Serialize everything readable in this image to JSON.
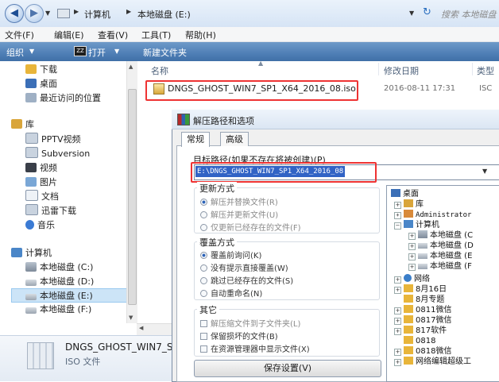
{
  "addressbar": {
    "crumbs": [
      "计算机",
      "本地磁盘 (E:)"
    ],
    "search_placeholder": "搜索 本地磁盘"
  },
  "menu": [
    "文件(F)",
    "编辑(E)",
    "查看(V)",
    "工具(T)",
    "帮助(H)"
  ],
  "toolbar": {
    "organize": "组织",
    "open": "打开",
    "new_folder": "新建文件夹"
  },
  "nav": {
    "favorites": [
      "下载",
      "桌面",
      "最近访问的位置"
    ],
    "library": "库",
    "library_items": [
      "PPTV视频",
      "Subversion",
      "视频",
      "图片",
      "文档",
      "迅雷下载",
      "音乐"
    ],
    "computer": "计算机",
    "drives": [
      "本地磁盘 (C:)",
      "本地磁盘 (D:)",
      "本地磁盘 (E:)",
      "本地磁盘 (F:)"
    ]
  },
  "filelist": {
    "columns": [
      "名称",
      "修改日期",
      "类型"
    ],
    "file": {
      "name": "DNGS_GHOST_WIN7_SP1_X64_2016_08.iso",
      "date": "2016-08-11 17:31",
      "type": "ISC"
    }
  },
  "details": {
    "name": "DNGS_GHOST_WIN7_S",
    "type": "ISO 文件"
  },
  "dialog": {
    "title": "解压路径和选项",
    "tabs": [
      "常规",
      "高级"
    ],
    "path_label": "目标路径(如果不存在将被创建)(P)",
    "path_value": "E:\\DNGS_GHOST_WIN7_SP1_X64_2016_08",
    "update_title": "更新方式",
    "update_opts": [
      "解压并替换文件(R)",
      "解压并更新文件(U)",
      "仅更新已经存在的文件(F)"
    ],
    "overwrite_title": "覆盖方式",
    "overwrite_opts": [
      "覆盖前询问(K)",
      "没有提示直接覆盖(W)",
      "跳过已经存在的文件(S)",
      "自动重命名(N)"
    ],
    "other_title": "其它",
    "other_opts": [
      "解压缩文件到子文件夹(L)",
      "保留损坏的文件(B)",
      "在资源管理器中显示文件(X)"
    ],
    "save_btn": "保存设置(V)",
    "tree": [
      "桌面",
      "库",
      "Administrator",
      "计算机",
      "本地磁盘 (C",
      "本地磁盘 (D",
      "本地磁盘 (E",
      "本地磁盘 (F",
      "网络",
      "8月16日",
      "8月专题",
      "0811微信",
      "0817微信",
      "817软件",
      "0818",
      "0818微信",
      "网络编辑超级工"
    ]
  }
}
